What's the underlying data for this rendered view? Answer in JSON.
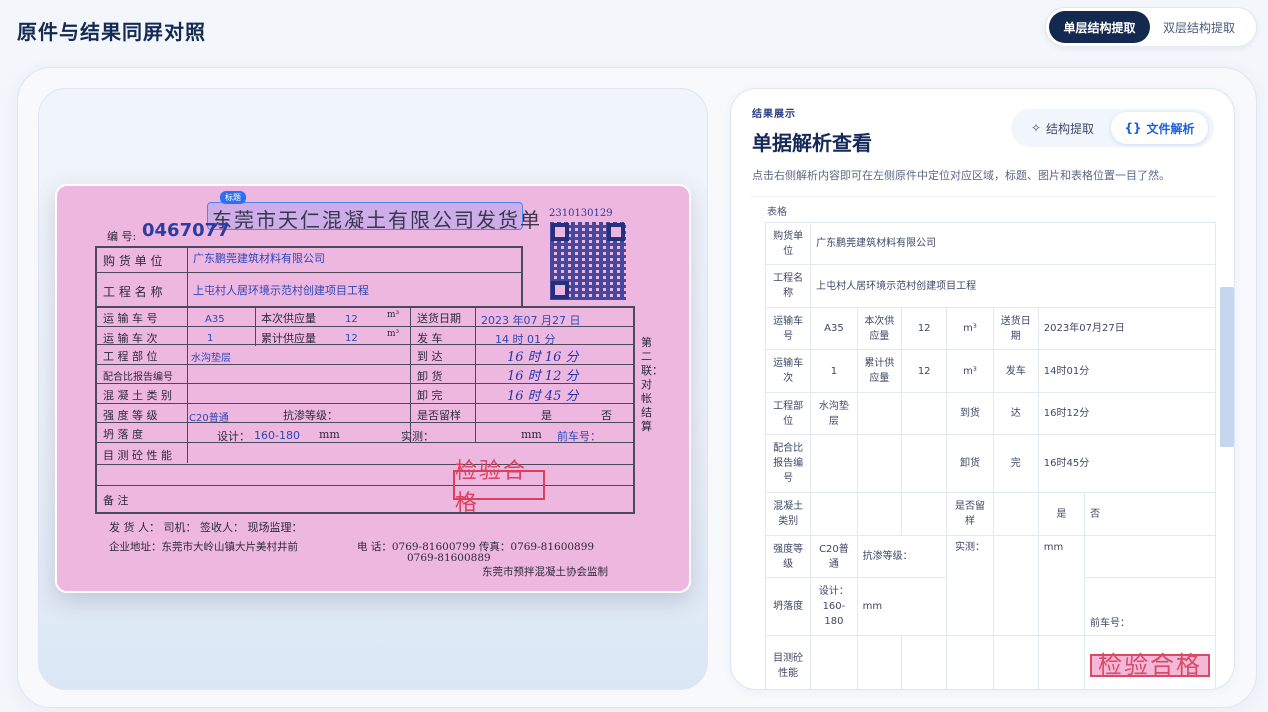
{
  "header": {
    "title": "原件与结果同屏对照",
    "modes": [
      "单层结构提取",
      "双层结构提取"
    ]
  },
  "doc": {
    "title": "东莞市天仁混凝土有限公司发货单",
    "tag": "标题",
    "serial": "2310130129",
    "number_label": "编 号:",
    "number": "0467077",
    "labels": {
      "buyer": "购 货 单 位",
      "project": "工 程 名 称",
      "truck": "运 输 车 号",
      "trips": "运 输 车 次",
      "site": "工 程 部 位",
      "mix": "配合比报告编号",
      "type": "混 凝 土 类 别",
      "strength": "强 度 等 级",
      "slump": "坍   落   度",
      "visual": "目 测 砼 性 能",
      "note": "备         注",
      "qty": "本次供应量",
      "cum": "累计供应量",
      "date": "送货日期",
      "depart": "发     车",
      "arrive": "到     达",
      "unload": "卸     货",
      "done": "卸     完",
      "impermeable": "抗渗等级：",
      "retain": "是否留样",
      "design": "设计：",
      "mm": "mm",
      "measured": "实测：",
      "front": "前车号：",
      "side": "第二联：对帐结算"
    },
    "values": {
      "buyer": "广东鹏莞建筑材料有限公司",
      "project": "上屯村人居环境示范村创建项目工程",
      "truck": "A35",
      "trips": "1",
      "qty": "12",
      "cum": "12",
      "unit": "m³",
      "date": "2023 年07 月27 日",
      "depart": "14 时  01    分",
      "arrive": "16 时 16  分",
      "unload": "16 时 12  分",
      "done": "16 时 45  分",
      "site": "水沟垫层",
      "strength": "C20普通",
      "slump": "160-180",
      "yes": "是",
      "no": "否",
      "stamp": "检验合格"
    },
    "footer": {
      "line1": "发 货 人：         司机：              签收人：              现场监理：",
      "address": "企业地址：东莞市大岭山镇大片美村井前",
      "phone": "电  话：0769-81600799  传真：0769-81600899",
      "phone2": "0769-81600889",
      "supervise": "东莞市预拌混凝土协会监制"
    }
  },
  "panel": {
    "eyebrow": "结果展示",
    "title": "单据解析查看",
    "desc": "点击右侧解析内容即可在左侧原件中定位对应区域，标题、图片和表格位置一目了然。",
    "tabs": [
      {
        "icon": "✧",
        "label": "结构提取"
      },
      {
        "icon": "{}",
        "label": "文件解析"
      }
    ],
    "section": "表格",
    "table": {
      "buyer_label": "购货单位",
      "buyer": "广东鹏莞建筑材料有限公司",
      "project_label": "工程名称",
      "project": "上屯村人居环境示范村创建项目工程",
      "truck_label": "运输车号",
      "truck": "A35",
      "qty_label": "本次供应量",
      "qty": "12",
      "unit": "m³",
      "date_label": "送货日期",
      "date": "2023年07月27日",
      "trips_label": "运输车次",
      "trips": "1",
      "cum_label": "累计供应量",
      "cum": "12",
      "depart": "发车",
      "depart_time": "14时01分",
      "site_label": "工程部位",
      "site": "水沟垫层",
      "arrive_goods": "到货",
      "arrive": "达",
      "arrive_time": "16时12分",
      "mix_label": "配合比报告编号",
      "unload": "卸货",
      "done": "完",
      "done_time": "16时45分",
      "type_label": "混凝土类别",
      "retain": "是否留样",
      "yes": "是",
      "no": "否",
      "strength_label": "强度等级",
      "strength": "C20普通",
      "impermeable": "抗渗等级：",
      "measured": "实测：",
      "mm": "mm",
      "slump_label": "坍落度",
      "design": "设计：160-180",
      "front": "前车号：",
      "visual_label": "目测砼性能",
      "stamp": "检验合格"
    }
  }
}
